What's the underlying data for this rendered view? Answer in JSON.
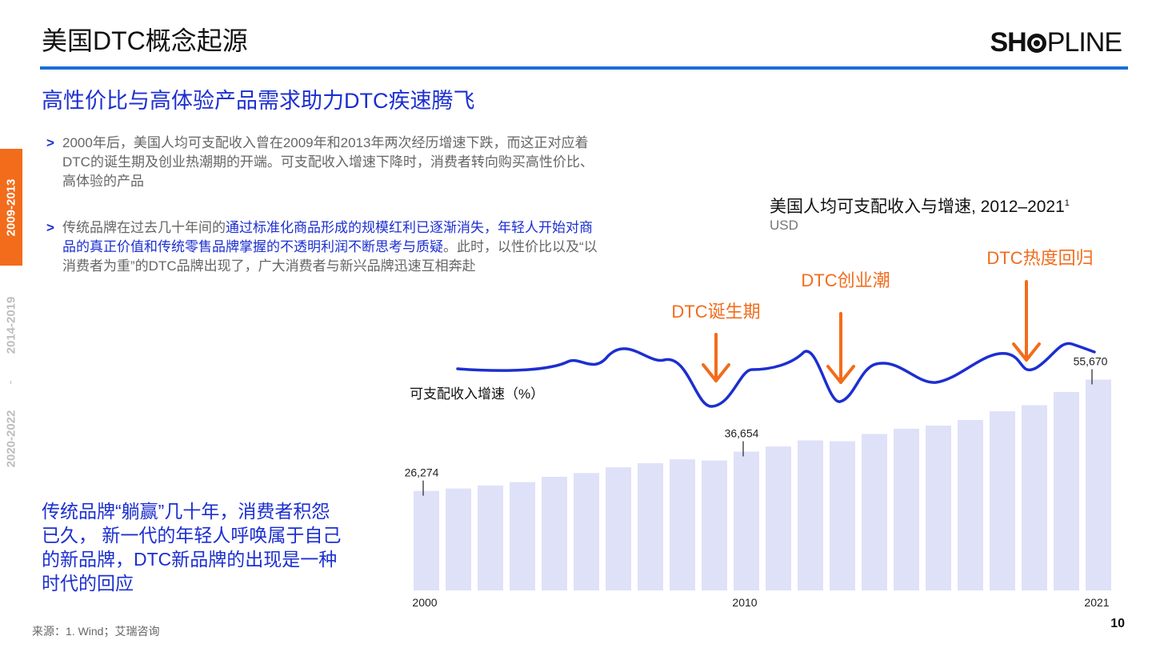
{
  "header": {
    "title": "美国DTC概念起源",
    "logo_bold": "SH",
    "logo_thin": "PLINE",
    "subtitle": "高性价比与高体验产品需求助力DTC疾速腾飞"
  },
  "sidebar": {
    "tabs": [
      {
        "label": "2009-2013",
        "active": true
      },
      {
        "label": "2014-2019",
        "active": false
      },
      {
        "label": "2020-2022",
        "active": false
      }
    ]
  },
  "bullets": {
    "marker": ">",
    "b1": "2000年后，美国人均可支配收入曾在2009年和2013年两次经历增速下跌，而这正对应着DTC的诞生期及创业热潮期的开端。可支配收入增速下降时，消费者转向购买高性价比、高体验的产品",
    "b2_pre": "传统品牌在过去几十年间的",
    "b2_highlight": "通过标准化商品形成的规模红利已逐渐消失，年轻人开始对商品的真正价值和传统零售品牌掌握的不透明利润不断思考与质疑",
    "b2_post": "。此时，以性价比以及“以消费者为重”的DTC品牌出现了，广大消费者与新兴品牌迅速互相奔赴"
  },
  "callout": "传统品牌“躺赢”几十年，消费者积怨已久， 新一代的年轻人呼唤属于自己的新品牌，DTC新品牌的出现是一种时代的回应",
  "chart_title": "美国人均可支配收入与增速, 2012–2021",
  "chart_title_sup": "1",
  "chart_unit": "USD",
  "footer": {
    "source": "来源：1. Wind；艾瑞咨询",
    "page": "10"
  },
  "colors": {
    "accent_blue": "#1c2fd0",
    "rule_blue": "#1a6fd6",
    "orange": "#f26c1c",
    "bar": "#dfe1f8"
  },
  "chart_data": {
    "type": "bar",
    "x": [
      2000,
      2001,
      2002,
      2003,
      2004,
      2005,
      2006,
      2007,
      2008,
      2009,
      2010,
      2011,
      2012,
      2013,
      2014,
      2015,
      2016,
      2017,
      2018,
      2019,
      2020,
      2021
    ],
    "values": [
      26274,
      26900,
      27700,
      28600,
      30000,
      31000,
      32500,
      33600,
      34600,
      34300,
      36654,
      38000,
      39600,
      39400,
      41300,
      42700,
      43500,
      45000,
      47300,
      48900,
      52400,
      55670
    ],
    "data_labels": [
      {
        "year": 2000,
        "text": "26,274"
      },
      {
        "year": 2010,
        "text": "36,654"
      },
      {
        "year": 2021,
        "text": "55,670"
      }
    ],
    "x_tick_labels": [
      "2000",
      "2010",
      "2021"
    ],
    "ylim": [
      0,
      60000
    ],
    "growth_line_label": "可支配收入增速（%）",
    "growth_line_color": "#1c2fd0",
    "annotations": [
      {
        "label": "DTC诞生期",
        "year": 2009
      },
      {
        "label": "DTC创业潮",
        "year": 2013
      },
      {
        "label": "DTC热度回归",
        "year": 2019
      }
    ]
  }
}
